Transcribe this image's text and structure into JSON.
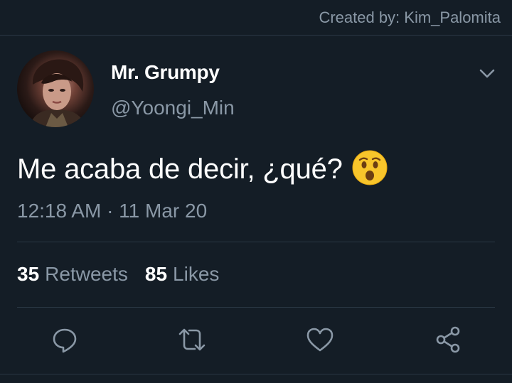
{
  "credit": "Created by: Kim_Palomita",
  "user": {
    "display_name": "Mr. Grumpy",
    "handle": "@Yoongi_Min"
  },
  "tweet": {
    "text": "Me acaba de decir, ¿qué?",
    "emoji": "hushed-face-emoji",
    "timestamp": "12:18 AM · 11 Mar 20"
  },
  "stats": {
    "retweets_count": "35",
    "retweets_label": "Retweets",
    "likes_count": "85",
    "likes_label": "Likes"
  },
  "actions": [
    {
      "name": "reply",
      "icon": "reply-icon"
    },
    {
      "name": "retweet",
      "icon": "retweet-icon"
    },
    {
      "name": "like",
      "icon": "heart-icon"
    },
    {
      "name": "share",
      "icon": "share-icon"
    }
  ],
  "colors": {
    "background": "#141d26",
    "secondary_text": "#8a98a6",
    "divider": "#2a3744"
  }
}
